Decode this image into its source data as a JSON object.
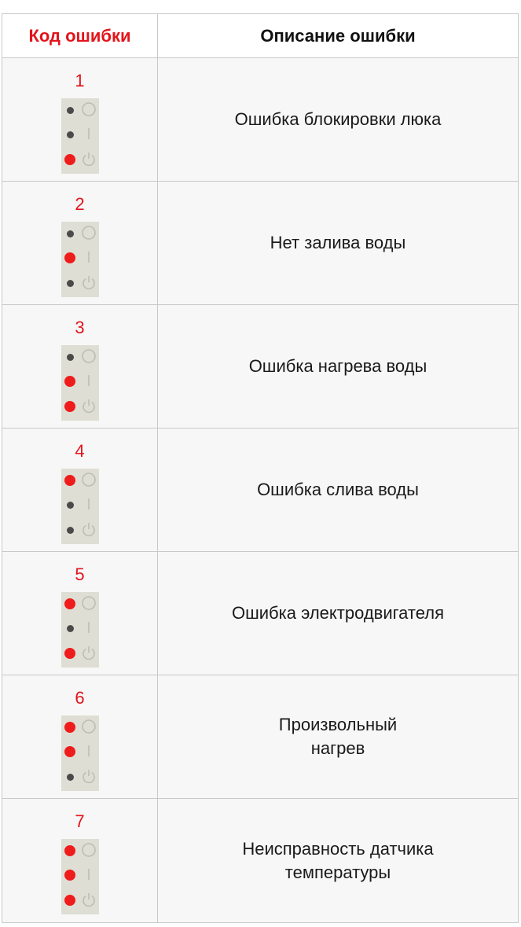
{
  "header": {
    "code_label": "Код ошибки",
    "desc_label": "Описание ошибки"
  },
  "colors": {
    "accent_red": "#e3141b",
    "lamp_on": "#ef1c1c",
    "lamp_off": "#4a4a4a",
    "panel_bg": "#deded4"
  },
  "rows": [
    {
      "code": "1",
      "lamps": [
        "off",
        "off",
        "on"
      ],
      "desc": "Ошибка блокировки люка"
    },
    {
      "code": "2",
      "lamps": [
        "off",
        "on",
        "off"
      ],
      "desc": "Нет залива воды"
    },
    {
      "code": "3",
      "lamps": [
        "off",
        "on",
        "on"
      ],
      "desc": "Ошибка нагрева воды"
    },
    {
      "code": "4",
      "lamps": [
        "on",
        "off",
        "off"
      ],
      "desc": "Ошибка слива воды"
    },
    {
      "code": "5",
      "lamps": [
        "on",
        "off",
        "on"
      ],
      "desc": "Ошибка электродвигателя"
    },
    {
      "code": "6",
      "lamps": [
        "on",
        "on",
        "off"
      ],
      "desc": "Произвольный\nнагрев"
    },
    {
      "code": "7",
      "lamps": [
        "on",
        "on",
        "on"
      ],
      "desc": "Неисправность датчика\nтемпературы"
    }
  ],
  "icons": {
    "top": "circle-icon",
    "middle": "line-icon",
    "bottom": "power-icon"
  }
}
